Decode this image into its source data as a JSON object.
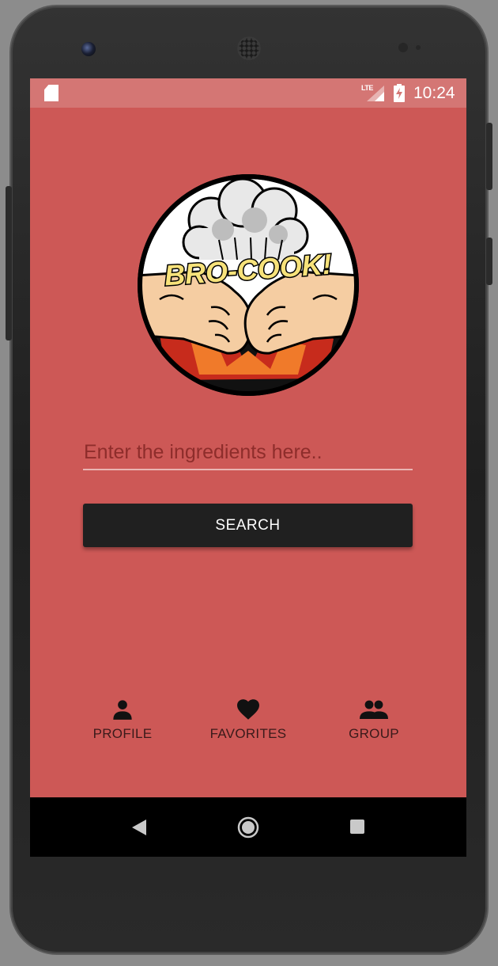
{
  "status_bar": {
    "network": "LTE",
    "time": "10:24",
    "icons": [
      "sd-card-icon",
      "signal-icon",
      "battery-charging-icon"
    ]
  },
  "logo": {
    "text": "BRO-COOK!",
    "icon": "fist-bump-chef-hat-logo"
  },
  "search": {
    "placeholder": "Enter the ingredients here..",
    "value": "",
    "button_label": "SEARCH"
  },
  "bottom_nav": {
    "items": [
      {
        "label": "PROFILE",
        "icon": "person-icon"
      },
      {
        "label": "FAVORITES",
        "icon": "heart-icon"
      },
      {
        "label": "GROUP",
        "icon": "group-icon"
      }
    ]
  },
  "system_nav": {
    "icons": [
      "back-icon",
      "home-icon",
      "recents-icon"
    ]
  },
  "colors": {
    "background": "#cd5856",
    "status_bar": "#d47674",
    "button": "#202020",
    "logo_yellow": "#f7e27a"
  }
}
